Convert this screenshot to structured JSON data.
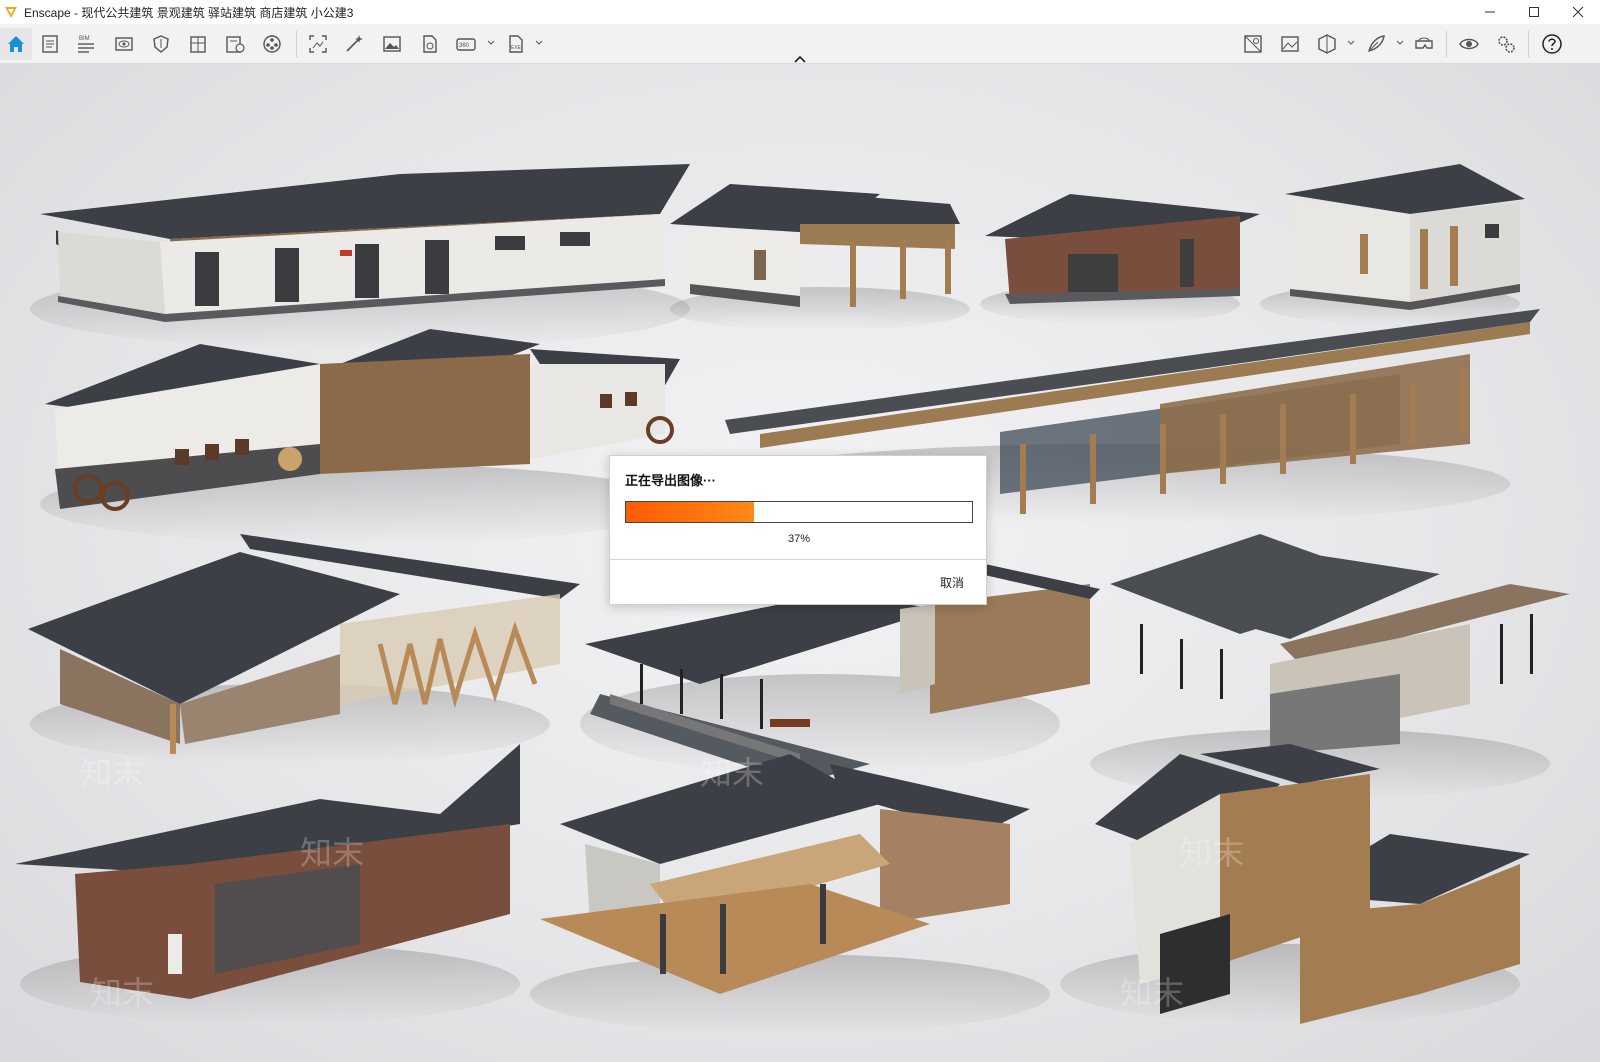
{
  "window": {
    "title": "Enscape - 现代公共建筑 景观建筑 驿站建筑 商店建筑 小公建3"
  },
  "toolbar": {
    "left_icons": [
      "home-icon",
      "document-icon",
      "bim-icon",
      "eye-icon",
      "shield-icon",
      "panel-icon",
      "settings-panel-icon",
      "film-reel-icon",
      "screenshot-icon",
      "magic-wand-icon",
      "image-icon",
      "batch-render-icon",
      "panorama-360-icon",
      "export-exe-icon"
    ],
    "bim_label": "BIM",
    "panorama_label": "360",
    "export_label": "EXE",
    "right_icons": [
      "material-icon",
      "gallery-icon",
      "cube-view-icon",
      "feather-icon",
      "vr-headset-icon",
      "visual-settings-eye-icon",
      "gears-icon",
      "help-icon"
    ]
  },
  "colors": {
    "accent": "#1a8fd6",
    "progress_start": "#ff5a00",
    "progress_end": "#ff8a1a"
  },
  "watermark": "知末",
  "dialog": {
    "title": "正在导出图像···",
    "progress": 0.37,
    "progress_text": "37%",
    "cancel_label": "取消"
  }
}
